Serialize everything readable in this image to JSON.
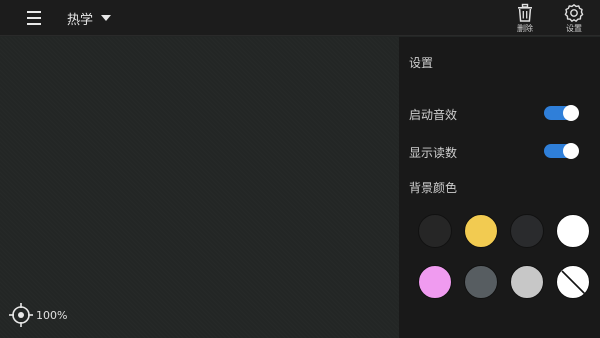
{
  "header": {
    "subject": "热学",
    "delete_label": "删除",
    "settings_label": "设置"
  },
  "canvas": {
    "zoom_text": "100%"
  },
  "settings": {
    "title": "设置",
    "sound": {
      "label": "启动音效",
      "on": true
    },
    "readout": {
      "label": "显示读数",
      "on": true
    },
    "bg_label": "背景颜色",
    "colors": [
      "#262626",
      "#f2cb51",
      "#2a2b2d",
      "#ffffff",
      "#f09bf0",
      "#575d61",
      "#c7c7c7",
      "none"
    ]
  },
  "icons": [
    "menu-icon",
    "caret-down-icon",
    "trash-icon",
    "gear-icon",
    "crosshair-icon"
  ]
}
